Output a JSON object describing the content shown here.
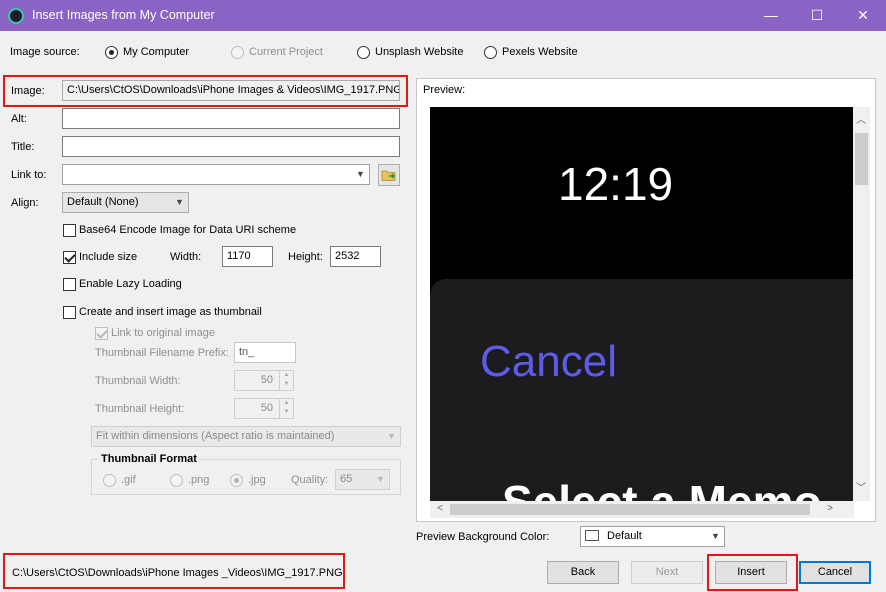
{
  "window": {
    "title": "Insert Images from My Computer",
    "minimize_glyph": "—",
    "maximize_glyph": "☐",
    "close_glyph": "✕"
  },
  "image_source": {
    "label": "Image source:",
    "options": [
      "My Computer",
      "Current Project",
      "Unsplash Website",
      "Pexels Website"
    ],
    "selected": "My Computer"
  },
  "form": {
    "image_label": "Image:",
    "image_value": "C:\\Users\\CtOS\\Downloads\\iPhone Images & Videos\\IMG_1917.PNG",
    "alt_label": "Alt:",
    "alt_value": "",
    "title_label": "Title:",
    "title_value": "",
    "link_label": "Link to:",
    "link_value": "",
    "align_label": "Align:",
    "align_value": "Default (None)",
    "base64_label": "Base64 Encode Image for Data URI scheme",
    "include_size_label": "Include size",
    "width_label": "Width:",
    "width_value": "1170",
    "height_label": "Height:",
    "height_value": "2532",
    "lazy_label": "Enable Lazy Loading",
    "thumbnail_label": "Create and insert image as thumbnail"
  },
  "thumbnail": {
    "link_original_label": "Link to original image",
    "prefix_label": "Thumbnail Filename Prefix:",
    "prefix_value": "tn_",
    "width_label": "Thumbnail Width:",
    "width_value": "50",
    "height_label": "Thumbnail Height:",
    "height_value": "50",
    "fit_value": "Fit within dimensions (Aspect ratio is maintained)",
    "format_title": "Thumbnail Format",
    "format_options": [
      ".gif",
      ".png",
      ".jpg"
    ],
    "format_selected": ".jpg",
    "quality_label": "Quality:",
    "quality_value": "65"
  },
  "preview": {
    "label": "Preview:",
    "time": "12:19",
    "cancel_text": "Cancel",
    "memo_text": "Select a Memo",
    "bg_label": "Preview Background Color:",
    "bg_value": "Default"
  },
  "footer": {
    "path": "C:\\Users\\CtOS\\Downloads\\iPhone Images _Videos\\IMG_1917.PNG",
    "back": "Back",
    "next": "Next",
    "insert": "Insert",
    "cancel": "Cancel"
  },
  "colors": {
    "titlebar": "#8a63c5",
    "highlight": "#e01818",
    "cancel_text": "#5e5ce6"
  }
}
